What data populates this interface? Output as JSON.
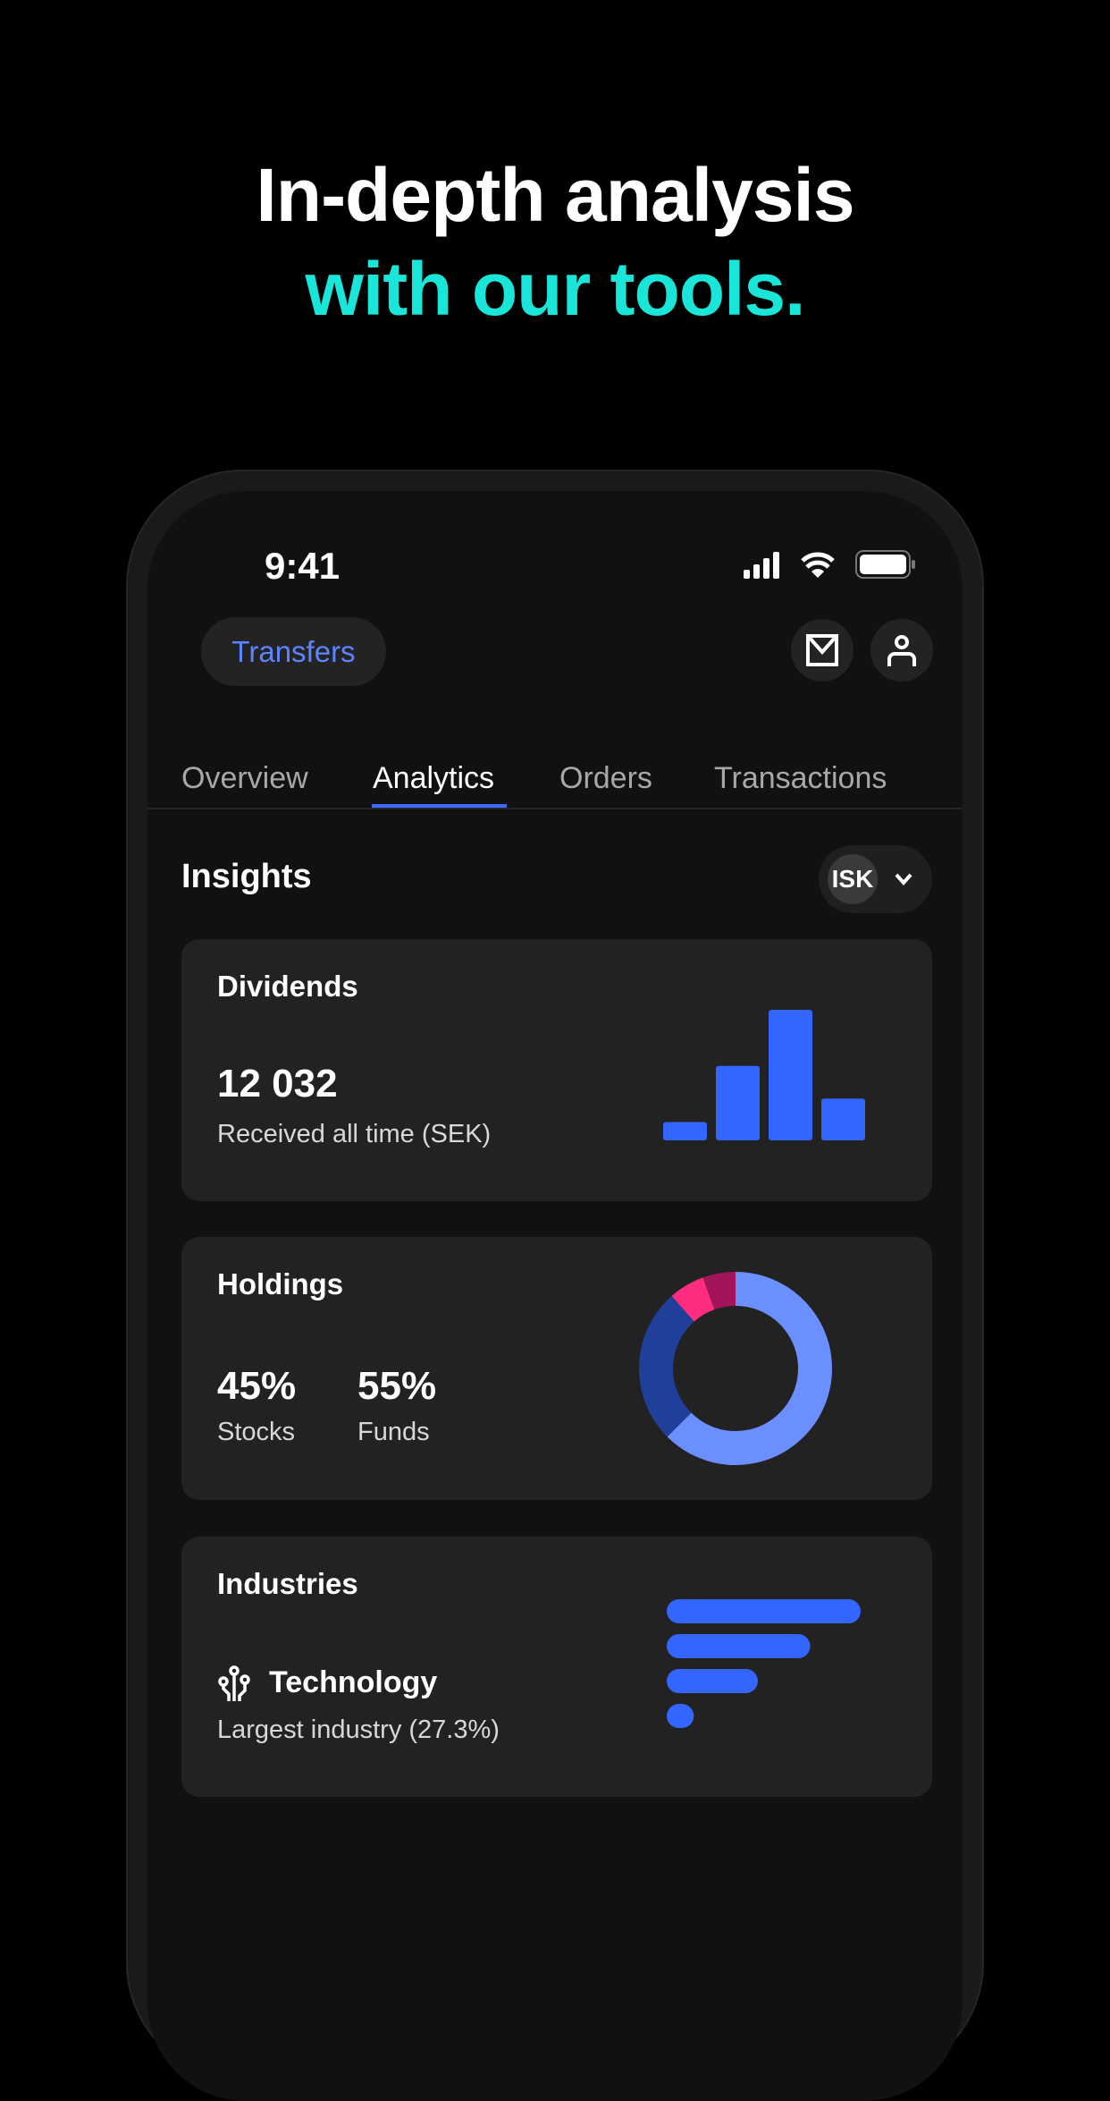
{
  "headline": {
    "line1": "In-depth analysis",
    "line2": "with our tools."
  },
  "status_bar": {
    "time": "9:41",
    "icons": [
      "signal-icon",
      "wifi-icon",
      "battery-icon"
    ]
  },
  "header": {
    "transfers_label": "Transfers",
    "icons": [
      "mail-icon",
      "profile-icon"
    ]
  },
  "tabs": [
    {
      "label": "Overview",
      "active": false
    },
    {
      "label": "Analytics",
      "active": true
    },
    {
      "label": "Orders",
      "active": false
    },
    {
      "label": "Transactions",
      "active": false
    }
  ],
  "insights": {
    "title": "Insights",
    "account_selector": "ISK"
  },
  "dividends": {
    "title": "Dividends",
    "value": "12 032",
    "caption": "Received all time (SEK)"
  },
  "holdings": {
    "title": "Holdings",
    "stocks_value": "45%",
    "stocks_label": "Stocks",
    "funds_value": "55%",
    "funds_label": "Funds"
  },
  "industries": {
    "title": "Industries",
    "top_industry": "Technology",
    "caption": "Largest industry (27.3%)",
    "icon": "technology-circuit-icon"
  },
  "colors": {
    "accent": "#3d6bff",
    "headline_highlight": "#19e6d8",
    "bar": "#3366ff"
  },
  "chart_data": [
    {
      "type": "bar",
      "values": [
        14,
        57,
        100,
        32
      ],
      "color": "#3366ff"
    },
    {
      "type": "pie",
      "values": [
        62.5,
        26,
        6,
        5.5
      ],
      "colors": [
        "#6b8fff",
        "#1f3f9a",
        "#ff2d7f",
        "#a3155a"
      ],
      "donut": true
    },
    {
      "type": "bar",
      "orientation": "horizontal",
      "values": [
        100,
        74,
        47,
        14
      ],
      "color": "#3366ff"
    }
  ]
}
